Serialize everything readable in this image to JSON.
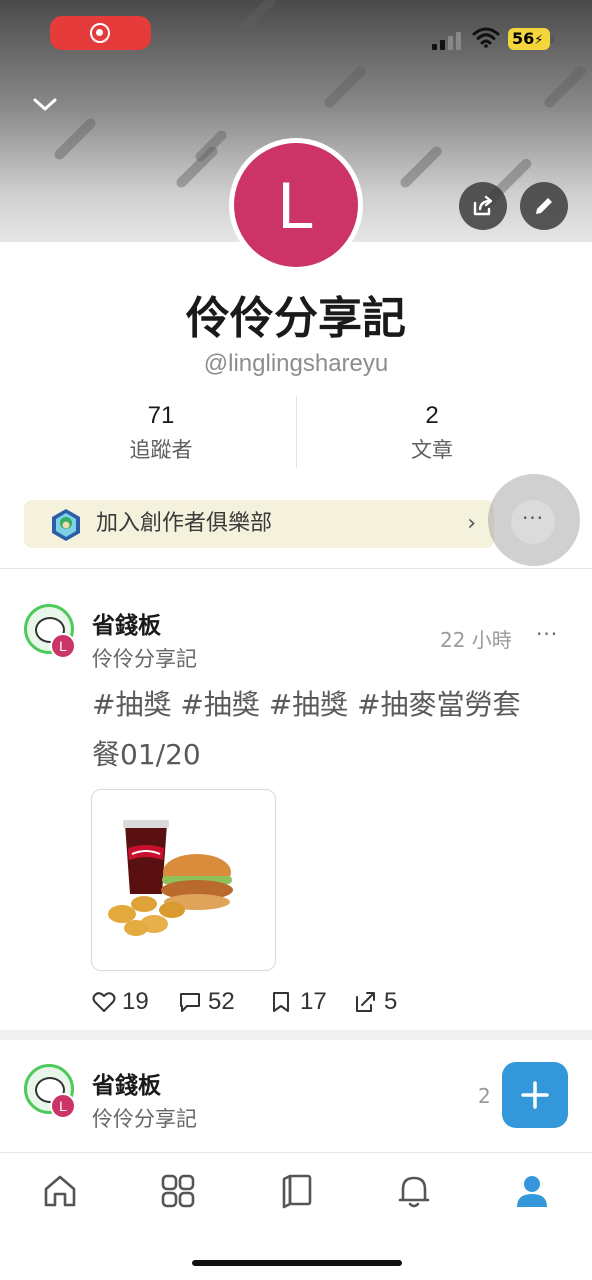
{
  "status_bar": {
    "battery_level": "56",
    "recording": true
  },
  "header": {
    "collapse_icon": "chevron-down-icon",
    "share_icon": "share-icon",
    "edit_icon": "pencil-icon"
  },
  "profile": {
    "avatar_letter": "L",
    "avatar_color": "#cc3468",
    "name": "伶伶分享記",
    "handle": "@linglingshareyu",
    "stats": [
      {
        "value": "71",
        "label": "追蹤者"
      },
      {
        "value": "2",
        "label": "文章"
      }
    ]
  },
  "club_banner": {
    "label": "加入創作者俱樂部",
    "chevron": "›"
  },
  "more_button": {
    "label": "···"
  },
  "posts": [
    {
      "board": "省錢板",
      "author": "伶伶分享記",
      "author_badge": "L",
      "time": "22 小時",
      "more": "···",
      "text": "#抽獎 #抽獎 #抽獎 #抽麥當勞套餐01/20",
      "image_alt": "mcdonalds-meal-image",
      "likes": "19",
      "comments": "52",
      "saves": "17",
      "shares": "5"
    },
    {
      "board": "省錢板",
      "author": "伶伶分享記",
      "author_badge": "L",
      "time": "2"
    }
  ],
  "fab": {
    "icon": "plus-icon"
  },
  "bottom_nav": [
    {
      "icon": "home-icon"
    },
    {
      "icon": "grid-icon"
    },
    {
      "icon": "cards-icon"
    },
    {
      "icon": "bell-icon"
    },
    {
      "icon": "profile-icon",
      "active": true
    }
  ],
  "colors": {
    "accent": "#3397d9",
    "brand_avatar": "#cc3468",
    "board_green": "#4ec95c",
    "club_banner_bg": "#f4f1dc"
  }
}
